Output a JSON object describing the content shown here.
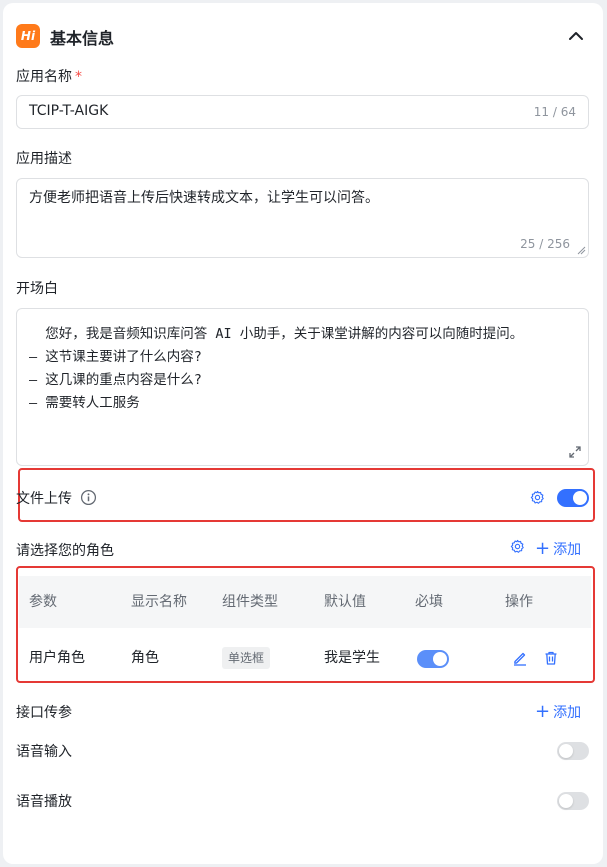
{
  "section": {
    "logo_text": "Hi",
    "title": "基本信息"
  },
  "app_name": {
    "label": "应用名称",
    "required_mark": "*",
    "value": "TCIP-T-AIGK",
    "counter": "11 / 64"
  },
  "app_desc": {
    "label": "应用描述",
    "value": "方便老师把语音上传后快速转成文本，让学生可以问答。",
    "counter": "25 / 256"
  },
  "opening": {
    "label": "开场白",
    "lines": [
      "  您好，我是音频知识库问答 AI 小助手，关于课堂讲解的内容可以向随时提问。",
      "– 这节课主要讲了什么内容?",
      "– 这几课的重点内容是什么?",
      "– 需要转人工服务"
    ]
  },
  "file_upload": {
    "label": "文件上传",
    "enabled": true
  },
  "role_select": {
    "label": "请选择您的角色",
    "add_label": "添加",
    "columns": [
      "参数",
      "显示名称",
      "组件类型",
      "默认值",
      "必填",
      "操作"
    ],
    "rows": [
      {
        "param": "用户角色",
        "display_name": "角色",
        "component_type": "单选框",
        "default_value": "我是学生",
        "required": true
      }
    ]
  },
  "api_params": {
    "label": "接口传参",
    "add_label": "添加"
  },
  "voice_input": {
    "label": "语音输入",
    "enabled": false
  },
  "voice_playback": {
    "label": "语音播放",
    "enabled": false
  },
  "colors": {
    "accent": "#3370ff",
    "highlight_border": "#e53935",
    "logo": "#ff7a1a"
  }
}
